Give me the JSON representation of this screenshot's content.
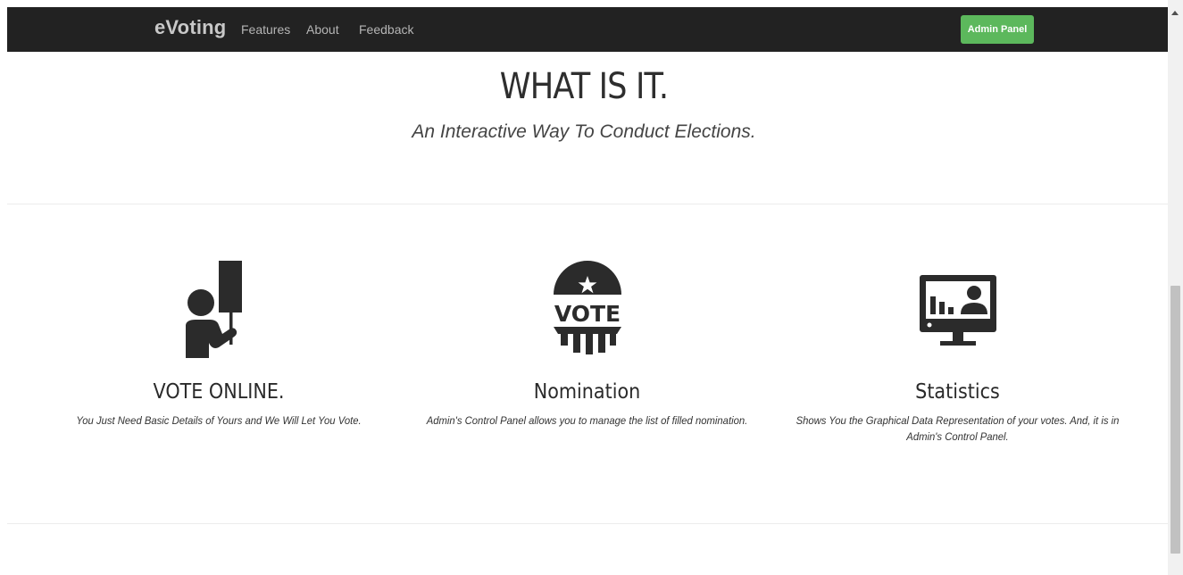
{
  "navbar": {
    "brand": "eVoting",
    "links": [
      "Features",
      "About",
      "Feedback"
    ],
    "admin_button": "Admin Panel",
    "admin_button_color": "#5cb85c",
    "background": "#222222"
  },
  "hero": {
    "title": "WHAT IS IT.",
    "subtitle": "An Interactive Way To Conduct Elections."
  },
  "features": [
    {
      "icon": "protester-sign-icon",
      "title": "VOTE ONLINE.",
      "description": "You Just Need Basic Details of Yours and We Will Let You Vote."
    },
    {
      "icon": "vote-badge-icon",
      "title": "Nomination",
      "description": "Admin's Control Panel allows you to manage the list of filled nomination.",
      "icon_text": "VOTE"
    },
    {
      "icon": "statistics-monitor-icon",
      "title": "Statistics",
      "description": "Shows You the Graphical Data Representation of your votes. And, it is in Admin's Control Panel."
    }
  ]
}
